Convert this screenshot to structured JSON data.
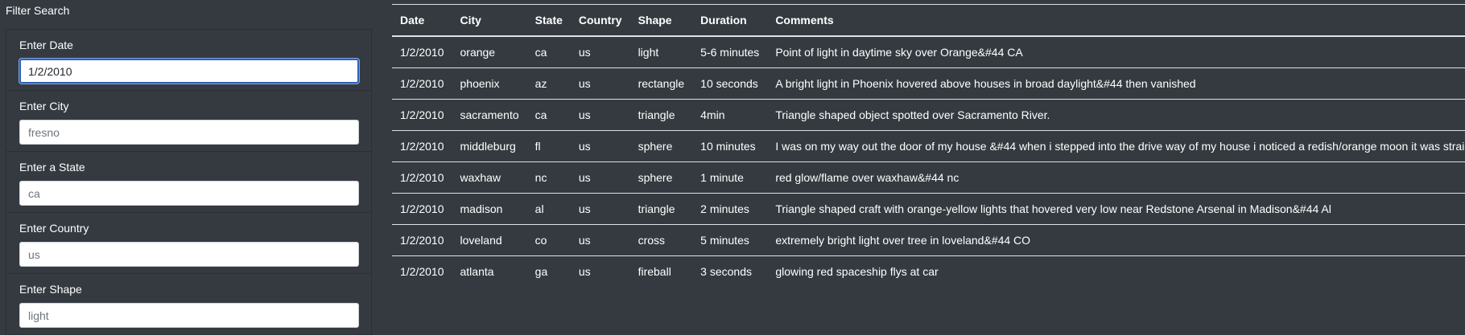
{
  "sidebar": {
    "title": "Filter Search",
    "filters": [
      {
        "label": "Enter Date",
        "value": "1/2/2010",
        "placeholder": ""
      },
      {
        "label": "Enter City",
        "value": "",
        "placeholder": "fresno"
      },
      {
        "label": "Enter a State",
        "value": "",
        "placeholder": "ca"
      },
      {
        "label": "Enter Country",
        "value": "",
        "placeholder": "us"
      },
      {
        "label": "Enter Shape",
        "value": "",
        "placeholder": "light"
      }
    ]
  },
  "table": {
    "headers": [
      "Date",
      "City",
      "State",
      "Country",
      "Shape",
      "Duration",
      "Comments"
    ],
    "rows": [
      [
        "1/2/2010",
        "orange",
        "ca",
        "us",
        "light",
        "5-6 minutes",
        "Point of light in daytime sky over Orange&#44 CA"
      ],
      [
        "1/2/2010",
        "phoenix",
        "az",
        "us",
        "rectangle",
        "10 seconds",
        "A bright light in Phoenix hovered above houses in broad daylight&#44 then vanished"
      ],
      [
        "1/2/2010",
        "sacramento",
        "ca",
        "us",
        "triangle",
        "4min",
        "Triangle shaped object spotted over Sacramento River."
      ],
      [
        "1/2/2010",
        "middleburg",
        "fl",
        "us",
        "sphere",
        "10 minutes",
        "I was on my way out the door of my house &#44 when i stepped into the drive way of my house i noticed a redish/orange moon it was straight"
      ],
      [
        "1/2/2010",
        "waxhaw",
        "nc",
        "us",
        "sphere",
        "1 minute",
        "red glow/flame over waxhaw&#44 nc"
      ],
      [
        "1/2/2010",
        "madison",
        "al",
        "us",
        "triangle",
        "2 minutes",
        "Triangle shaped craft with orange-yellow lights that hovered very low near Redstone Arsenal in Madison&#44 Al"
      ],
      [
        "1/2/2010",
        "loveland",
        "co",
        "us",
        "cross",
        "5 minutes",
        "extremely bright light over tree in loveland&#44 CO"
      ],
      [
        "1/2/2010",
        "atlanta",
        "ga",
        "us",
        "fireball",
        "3 seconds",
        "glowing red spaceship flys at car"
      ]
    ]
  }
}
